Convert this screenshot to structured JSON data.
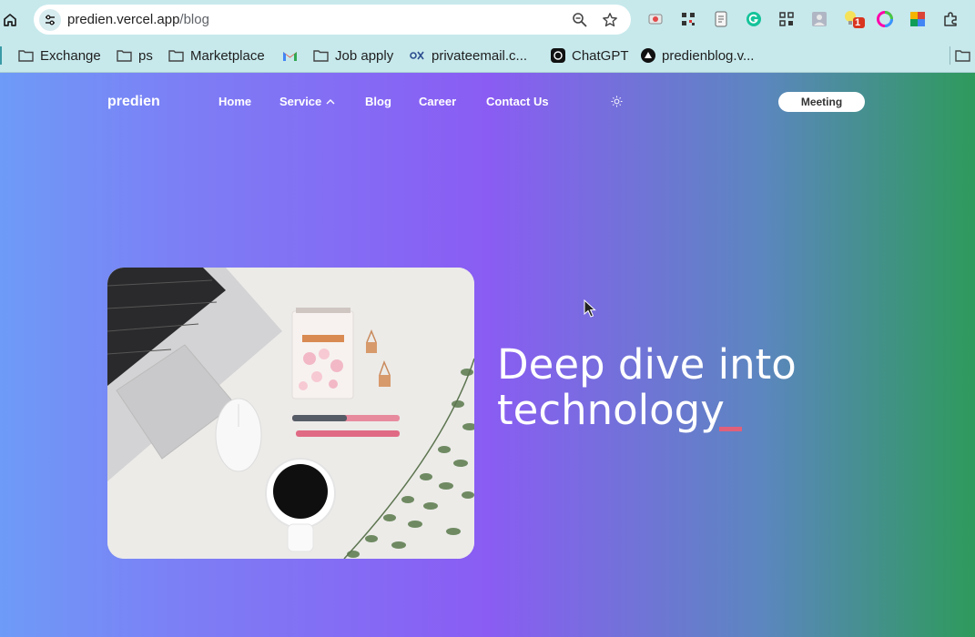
{
  "browser": {
    "url_host": "predien.vercel.app",
    "url_path": "/blog",
    "bookmarks": [
      {
        "label": "Exchange",
        "icon": "folder-icon"
      },
      {
        "label": "ps",
        "icon": "folder-icon"
      },
      {
        "label": "Marketplace",
        "icon": "folder-icon"
      },
      {
        "label": "",
        "icon": "gmail-icon"
      },
      {
        "label": "Job apply",
        "icon": "folder-icon"
      },
      {
        "label": "privateemail.c...",
        "icon": "privateemail-icon"
      },
      {
        "label": "ChatGPT",
        "icon": "chatgpt-icon"
      },
      {
        "label": "predienblog.v...",
        "icon": "vercel-icon"
      }
    ],
    "extension_badge": "1"
  },
  "site": {
    "brand": "predien",
    "nav": {
      "home": "Home",
      "service": "Service",
      "blog": "Blog",
      "career": "Career",
      "contact": "Contact Us"
    },
    "meeting_button": "Meeting",
    "headline_line1": "Deep dive into",
    "headline_line2": "technology"
  },
  "colors": {
    "chrome_bg": "#c7e9ec",
    "gradient_start": "#6e9bf7",
    "gradient_mid": "#8a5cf3",
    "gradient_end": "#2e9a5c",
    "typing_cursor": "#e0607a"
  }
}
